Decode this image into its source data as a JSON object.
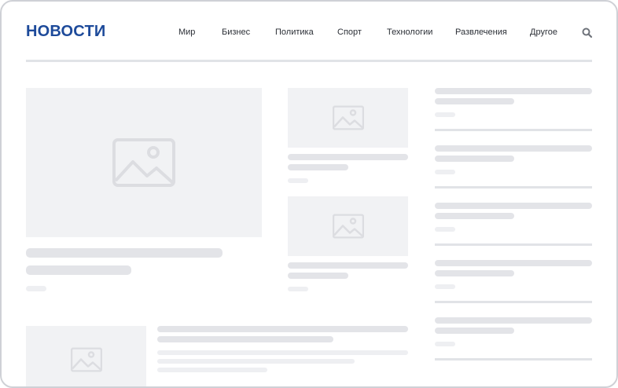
{
  "header": {
    "logo": "НОВОСТИ",
    "nav": [
      "Мир",
      "Бизнес",
      "Политика",
      "Спорт",
      "Технологии",
      "Развлечения",
      "Другое"
    ],
    "search_icon": "search-icon"
  },
  "colors": {
    "brand": "#1d4a9a",
    "placeholder_bg": "#f1f2f4",
    "skeleton": "#e3e4e8",
    "border": "#cfd1d6"
  }
}
